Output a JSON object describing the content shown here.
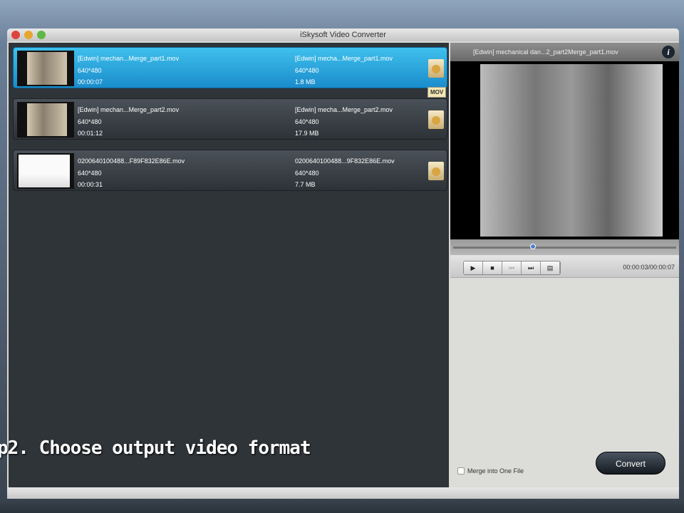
{
  "window": {
    "title": "iSkysoft Video Converter"
  },
  "files": [
    {
      "name": "[Edwin] mechan...Merge_part1.mov",
      "res": "640*480",
      "duration": "00:00:07",
      "out_name": "[Edwin] mecha...Merge_part1.mov",
      "out_res": "640*480",
      "out_size": "1.8 MB",
      "selected": true
    },
    {
      "name": "[Edwin] mechan...Merge_part2.mov",
      "res": "640*480",
      "duration": "00:01:12",
      "out_name": "[Edwin] mecha...Merge_part2.mov",
      "out_res": "640*480",
      "out_size": "17.9 MB",
      "selected": false
    },
    {
      "name": "0200640100488...F89F832E86E.mov",
      "res": "640*480",
      "duration": "00:00:31",
      "out_name": "0200640100488...9F832E86E.mov",
      "out_res": "640*480",
      "out_size": "7.7 MB",
      "selected": false
    }
  ],
  "format_tooltip": "MOV",
  "preview": {
    "title": "[Edwin] mechanical dan...2_part2Merge_part1.mov",
    "time": "00:00:03/00:00:07",
    "progress": 0.43,
    "buttons": [
      "▶",
      "■",
      "⏮",
      "⏭",
      "▤"
    ]
  },
  "merge_label": "Merge into One File",
  "convert_label": "Convert",
  "caption": "p2. Choose output video format"
}
